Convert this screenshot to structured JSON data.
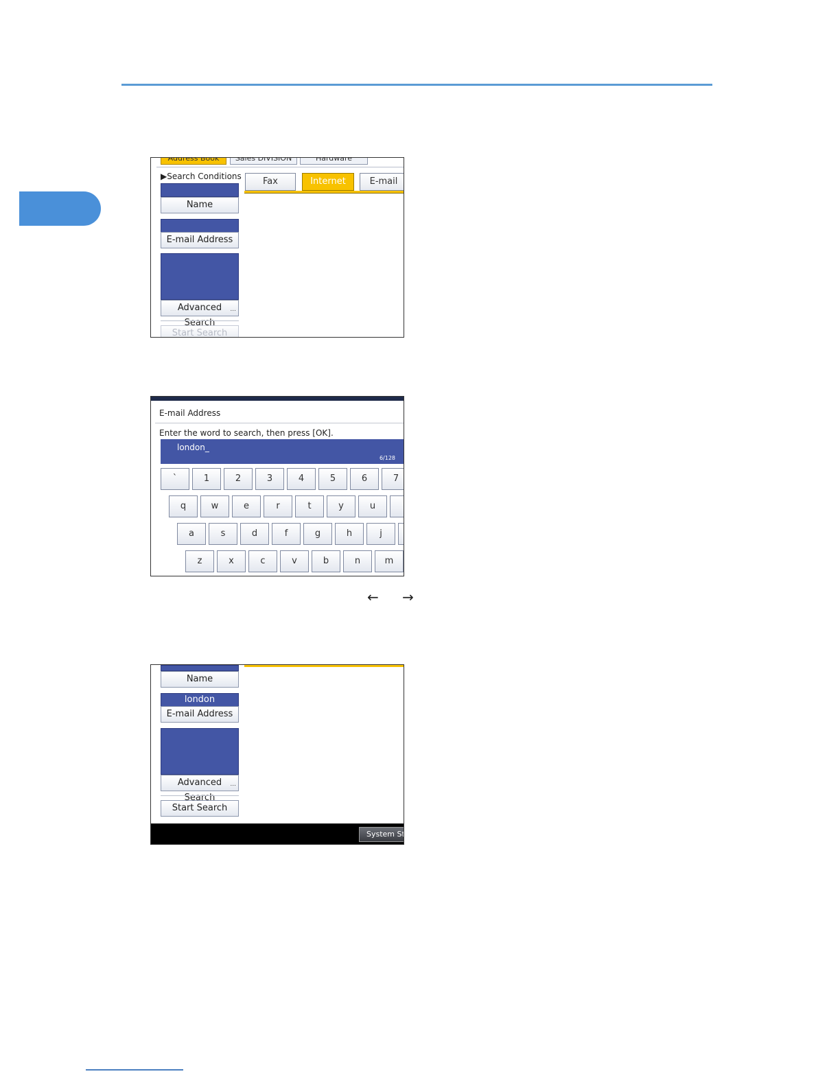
{
  "shot1": {
    "top_buttons": [
      "Address Book",
      "Sales DIVISION",
      "Hardware DIVISI..."
    ],
    "search_conditions_label": "▶Search Conditions",
    "name_button": "Name",
    "email_button": "E-mail Address",
    "advanced_search_button": "Advanced Search",
    "start_search_button": "Start Search",
    "tabs": [
      "Fax",
      "Internet Fax",
      "E-mail"
    ]
  },
  "shot2": {
    "title": "E-mail Address",
    "instruction": "Enter the word to search, then press [OK].",
    "input_value": "london_",
    "char_count": "6/128",
    "row1": [
      "`",
      "1",
      "2",
      "3",
      "4",
      "5",
      "6",
      "7"
    ],
    "row2": [
      "q",
      "w",
      "e",
      "r",
      "t",
      "y",
      "u"
    ],
    "row3": [
      "a",
      "s",
      "d",
      "f",
      "g",
      "h",
      "j"
    ],
    "row4": [
      "z",
      "x",
      "c",
      "v",
      "b",
      "n",
      "m"
    ]
  },
  "arrow_keys": "← →",
  "shot3": {
    "name_button": "Name",
    "email_value": "london",
    "email_button": "E-mail Address",
    "advanced_search_button": "Advanced Search",
    "start_search_button": "Start Search",
    "system_status_button": "System Statu"
  },
  "colors": {
    "accent_blue": "#5b9bd5",
    "field_blue": "#4356a5",
    "tab_yellow": "#f8c200"
  }
}
